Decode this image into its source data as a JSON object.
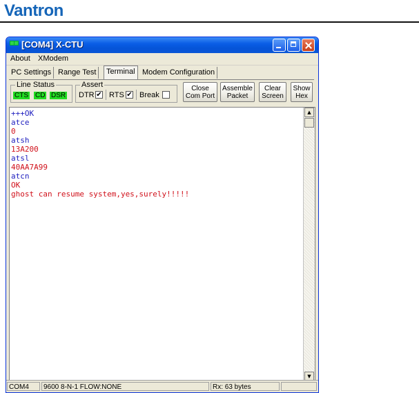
{
  "header": {
    "brand": "Vantron"
  },
  "window": {
    "title": "[COM4] X-CTU"
  },
  "menu": [
    "About",
    "XModem"
  ],
  "tabs": [
    {
      "label": "PC Settings",
      "active": false
    },
    {
      "label": "Range Test",
      "active": false
    },
    {
      "label": "Terminal",
      "active": true
    },
    {
      "label": "Modem Configuration",
      "active": false
    }
  ],
  "line_status": {
    "title": "Line Status",
    "indicators": [
      "CTS",
      "CD",
      "DSR"
    ],
    "indicator_color": "#22dd22"
  },
  "assert": {
    "title": "Assert",
    "dtr_label": "DTR",
    "dtr_checked": "✔",
    "rts_label": "RTS",
    "rts_checked": "✔",
    "break_label": "Break",
    "break_checked": ""
  },
  "buttons": {
    "close_com_port": [
      "Close",
      "Com Port"
    ],
    "assemble_packet": [
      "Assemble",
      "Packet"
    ],
    "clear_screen": [
      "Clear",
      "Screen"
    ],
    "show_hex": [
      "Show",
      "Hex"
    ]
  },
  "terminal": {
    "lines": [
      {
        "text": "+++OK",
        "color": "#1c1cbe"
      },
      {
        "text": "atce",
        "color": "#1c1cbe"
      },
      {
        "text": "0",
        "color": "#d0101a"
      },
      {
        "text": "atsh",
        "color": "#1c1cbe"
      },
      {
        "text": "13A200",
        "color": "#d0101a"
      },
      {
        "text": "atsl",
        "color": "#1c1cbe"
      },
      {
        "text": "40AA7A99",
        "color": "#d0101a"
      },
      {
        "text": "atcn",
        "color": "#1c1cbe"
      },
      {
        "text": "OK",
        "color": "#d0101a"
      },
      {
        "text": "ghost can resume system,yes,surely!!!!!",
        "color": "#d0101a"
      }
    ]
  },
  "status": {
    "port": "COM4",
    "settings": "9600 8-N-1  FLOW:NONE",
    "rx": "Rx: 63 bytes"
  }
}
